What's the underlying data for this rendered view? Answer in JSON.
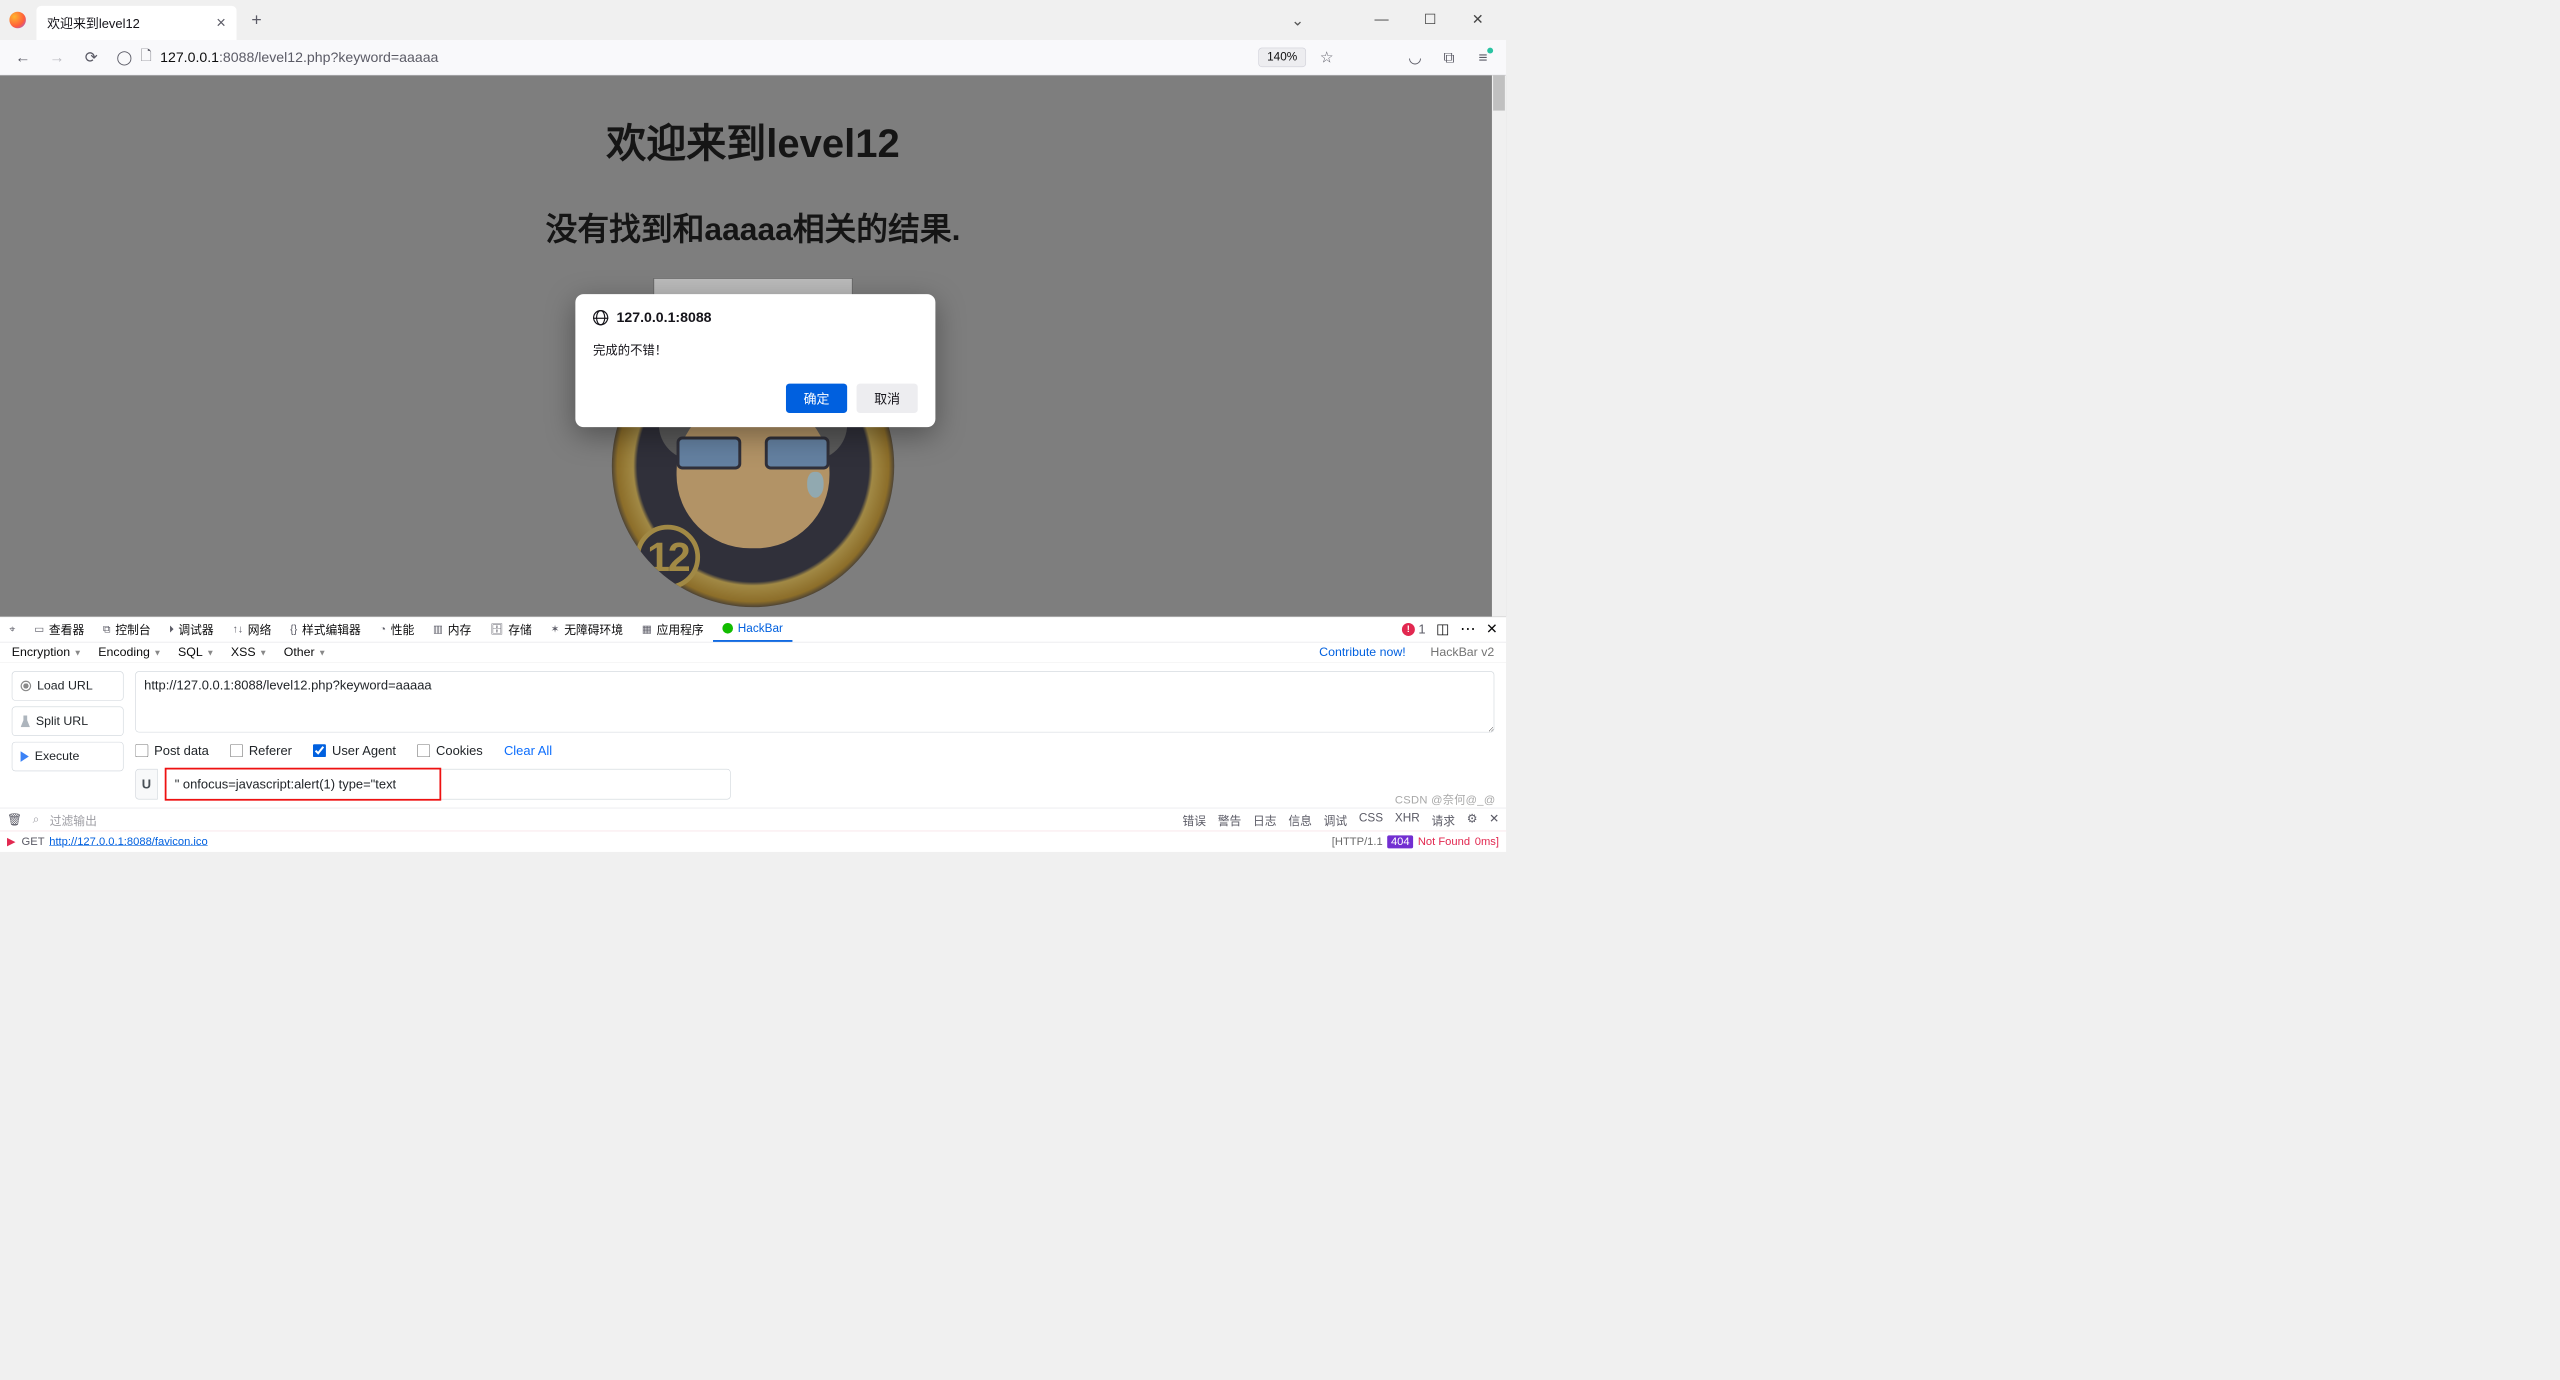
{
  "browser": {
    "tab_title": "欢迎来到level12",
    "url_host": "127.0.0.1",
    "url_port": ":8088",
    "url_path": "/level12.php?keyword=aaaaa",
    "zoom": "140%"
  },
  "page": {
    "heading": "欢迎来到level12",
    "subheading": "没有找到和aaaaa相关的结果.",
    "badge_number": "12"
  },
  "dialog": {
    "origin": "127.0.0.1:8088",
    "message": "完成的不错！",
    "ok": "确定",
    "cancel": "取消"
  },
  "devtools": {
    "tabs": [
      "查看器",
      "控制台",
      "调试器",
      "网络",
      "样式编辑器",
      "性能",
      "内存",
      "存储",
      "无障碍环境",
      "应用程序",
      "HackBar"
    ],
    "error_count": "1",
    "hackbar": {
      "menus": [
        "Encryption",
        "Encoding",
        "SQL",
        "XSS",
        "Other"
      ],
      "contribute": "Contribute now!",
      "version": "HackBar v2",
      "buttons": {
        "load": "Load URL",
        "split": "Split URL",
        "execute": "Execute"
      },
      "url_value": "http://127.0.0.1:8088/level12.php?keyword=aaaaa",
      "opts": {
        "post": "Post data",
        "referer": "Referer",
        "ua": "User Agent",
        "cookies": "Cookies",
        "clear": "Clear All"
      },
      "ua_label": "U",
      "ua_value": "\" onfocus=javascript:alert(1) type=\"text"
    },
    "console": {
      "filter_placeholder": "过滤输出",
      "filters": [
        "错误",
        "警告",
        "日志",
        "信息",
        "调试",
        "CSS",
        "XHR",
        "请求"
      ],
      "line": {
        "method": "GET",
        "url": "http://127.0.0.1:8088/favicon.ico",
        "proto": "[HTTP/1.1",
        "code": "404",
        "status": "Not Found",
        "time": "0ms]"
      }
    }
  },
  "watermark": "CSDN @奈何@_@"
}
